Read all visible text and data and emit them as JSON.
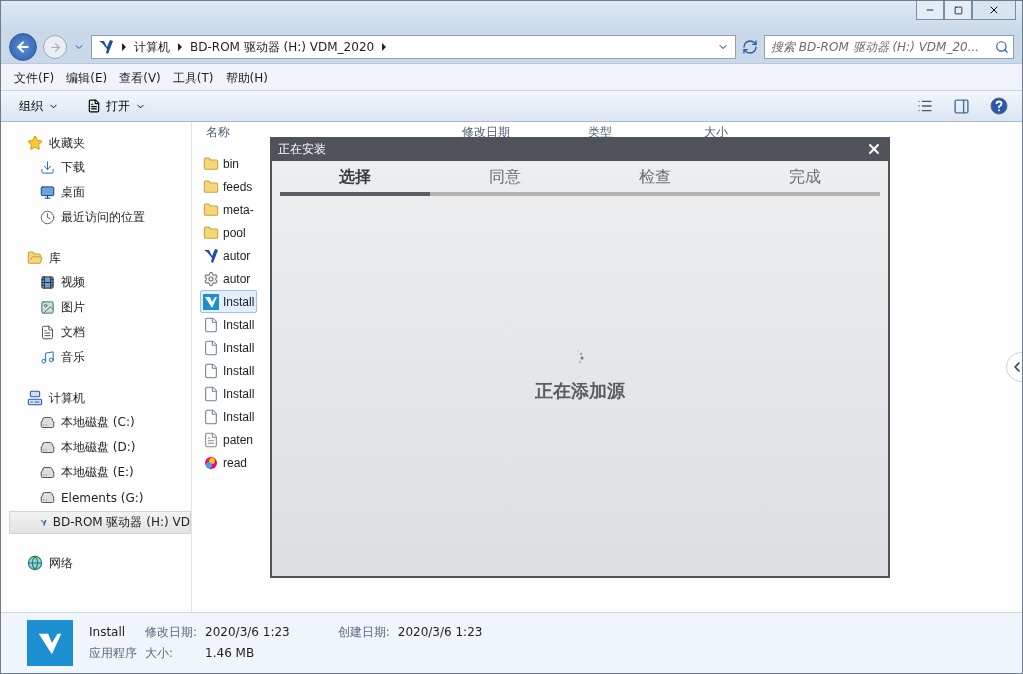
{
  "address_bar": {
    "segments": [
      "计算机",
      "BD-ROM 驱动器 (H:) VDM_2020"
    ]
  },
  "search": {
    "placeholder": "搜索 BD-ROM 驱动器 (H:) VDM_20..."
  },
  "menu": [
    "文件(F)",
    "编辑(E)",
    "查看(V)",
    "工具(T)",
    "帮助(H)"
  ],
  "toolbar": [
    "组织",
    "打开"
  ],
  "sidebar": {
    "groups": [
      {
        "label": "收藏夹",
        "items": [
          {
            "label": "下载",
            "selected": false
          },
          {
            "label": "桌面",
            "selected": false
          },
          {
            "label": "最近访问的位置",
            "selected": false
          }
        ]
      },
      {
        "label": "库",
        "items": [
          {
            "label": "视频",
            "selected": false
          },
          {
            "label": "图片",
            "selected": false
          },
          {
            "label": "文档",
            "selected": false
          },
          {
            "label": "音乐",
            "selected": false
          }
        ]
      },
      {
        "label": "计算机",
        "items": [
          {
            "label": "本地磁盘 (C:)",
            "selected": false
          },
          {
            "label": "本地磁盘 (D:)",
            "selected": false
          },
          {
            "label": "本地磁盘 (E:)",
            "selected": false
          },
          {
            "label": "Elements (G:)",
            "selected": false
          },
          {
            "label": "BD-ROM 驱动器 (H:) VD",
            "selected": true
          }
        ]
      },
      {
        "label": "网络"
      }
    ]
  },
  "table": {
    "columns": [
      "名称",
      "修改日期",
      "类型",
      "大小"
    ],
    "rows": [
      {
        "name": "bin",
        "kind": "folder",
        "selected": false
      },
      {
        "name": "feeds",
        "kind": "folder",
        "selected": false
      },
      {
        "name": "meta-",
        "kind": "folder",
        "selected": false
      },
      {
        "name": "pool",
        "kind": "folder",
        "selected": false
      },
      {
        "name": "autor",
        "kind": "logo",
        "selected": false
      },
      {
        "name": "autor",
        "kind": "config",
        "selected": false
      },
      {
        "name": "Install",
        "kind": "app",
        "selected": true
      },
      {
        "name": "Install",
        "kind": "library",
        "selected": false
      },
      {
        "name": "Install",
        "kind": "library",
        "selected": false
      },
      {
        "name": "Install",
        "kind": "library",
        "selected": false
      },
      {
        "name": "Install",
        "kind": "library",
        "selected": false
      },
      {
        "name": "Install",
        "kind": "library",
        "selected": false
      },
      {
        "name": "paten",
        "kind": "text",
        "selected": false
      },
      {
        "name": "read",
        "kind": "web",
        "selected": false
      }
    ]
  },
  "dialog": {
    "title": "正在安装",
    "steps": [
      {
        "label": "选择",
        "selected": true
      },
      {
        "label": "同意",
        "selected": false
      },
      {
        "label": "检查",
        "selected": false
      },
      {
        "label": "完成",
        "selected": false
      }
    ],
    "progress": {
      "level": 0.25
    },
    "message": "正在添加源"
  },
  "status_bar": {
    "name": "Install",
    "type": "应用程序",
    "fields": [
      {
        "label": "修改日期:",
        "value": "2020/3/6 1:23"
      },
      {
        "label": "创建日期:",
        "value": "2020/3/6 1:23"
      },
      {
        "label": "大小:",
        "value": "1.46 MB"
      }
    ]
  }
}
